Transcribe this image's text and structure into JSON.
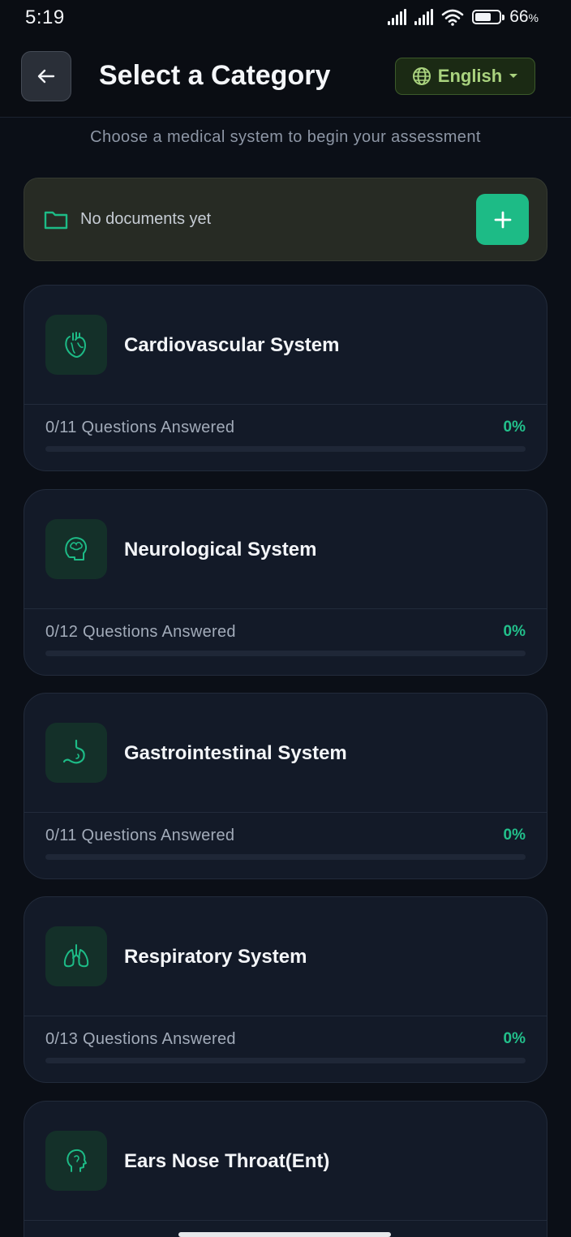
{
  "status_bar": {
    "time": "5:19",
    "battery_percent": "66",
    "battery_suffix": "%",
    "battery_level": 0.66
  },
  "header": {
    "title": "Select a Category",
    "language": "English"
  },
  "subtitle": "Choose a medical system to begin your assessment",
  "documents": {
    "empty_label": "No documents yet"
  },
  "categories": [
    {
      "name": "Cardiovascular System",
      "progress_text": "0/11 Questions Answered",
      "percent_text": "0%",
      "progress": 0,
      "icon": "heart-icon"
    },
    {
      "name": "Neurological System",
      "progress_text": "0/12 Questions Answered",
      "percent_text": "0%",
      "progress": 0,
      "icon": "brain-icon"
    },
    {
      "name": "Gastrointestinal System",
      "progress_text": "0/11 Questions Answered",
      "percent_text": "0%",
      "progress": 0,
      "icon": "stomach-icon"
    },
    {
      "name": "Respiratory System",
      "progress_text": "0/13 Questions Answered",
      "percent_text": "0%",
      "progress": 0,
      "icon": "lungs-icon"
    },
    {
      "name": "Ears Nose Throat(Ent)",
      "progress_text": "",
      "percent_text": "",
      "progress": 0,
      "icon": "ent-head-icon"
    }
  ],
  "colors": {
    "background": "#0b0f17",
    "card": "#131a28",
    "accent": "#1dbb86",
    "language_text": "#a9d27e"
  }
}
